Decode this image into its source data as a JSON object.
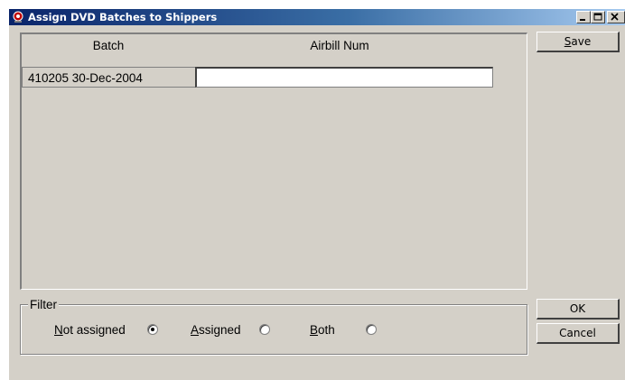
{
  "window": {
    "title": "Assign DVD Batches to Shippers",
    "minimize_label": "_",
    "maximize_label": "□",
    "close_label": "✕"
  },
  "grid": {
    "columns": [
      "Batch",
      "Airbill Num"
    ],
    "rows": [
      {
        "batch": "410205  30-Dec-2004",
        "airbill": ""
      }
    ]
  },
  "buttons": {
    "save": {
      "first": "S",
      "rest": "ave"
    },
    "ok": "OK",
    "cancel": "Cancel"
  },
  "filter": {
    "legend": "Filter",
    "options": [
      {
        "first": "N",
        "rest": "ot assigned",
        "selected": true
      },
      {
        "first": "A",
        "rest": "ssigned",
        "selected": false
      },
      {
        "first": "B",
        "rest": "oth",
        "selected": false
      }
    ]
  }
}
